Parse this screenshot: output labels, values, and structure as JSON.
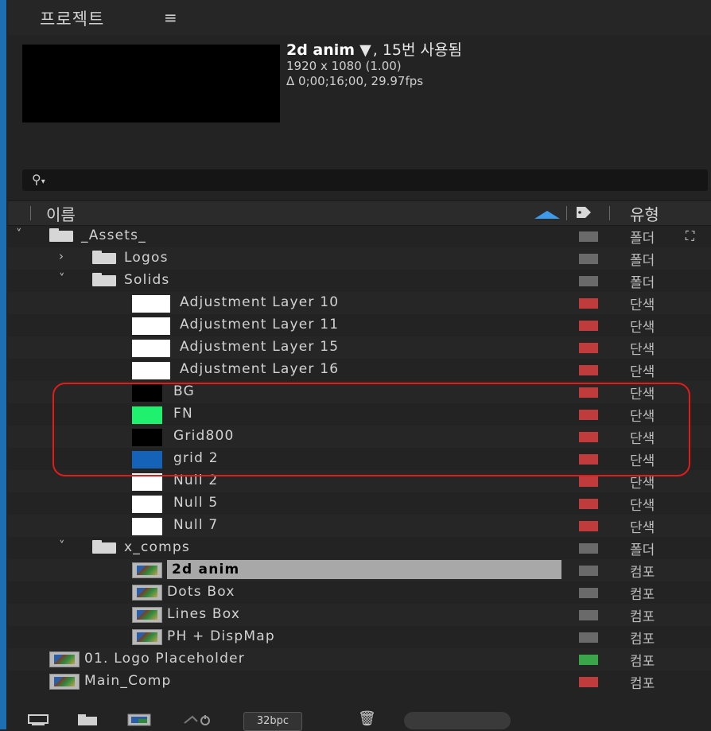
{
  "panel": {
    "title": "프로젝트",
    "menu_icon": "≡"
  },
  "preview": {
    "name": "2d anim",
    "caret": "▼",
    "usage": ", 15번 사용됨",
    "resolution": "1920 x 1080 (1.00)",
    "duration": "Δ 0;00;16;00, 29.97fps"
  },
  "search": {
    "value": "",
    "placeholder": ""
  },
  "columns": {
    "name": "이름",
    "type": "유형"
  },
  "items": [
    {
      "id": "assets",
      "indent": 0,
      "chevron": "˅",
      "icon": "folder",
      "name": "_Assets_",
      "label_color": "#6a6a6a",
      "type": "폴더"
    },
    {
      "id": "logos",
      "indent": 1,
      "chevron": "›",
      "icon": "folder",
      "name": "Logos",
      "label_color": "#6a6a6a",
      "type": "폴더"
    },
    {
      "id": "solids",
      "indent": 1,
      "chevron": "˅",
      "icon": "folder",
      "name": "Solids",
      "label_color": "#6a6a6a",
      "type": "폴더"
    },
    {
      "id": "adj10",
      "indent": 2,
      "icon": "solid",
      "swatch": "#ffffff",
      "name": "Adjustment Layer 10",
      "label_color": "#c03b3b",
      "type": "단색"
    },
    {
      "id": "adj11",
      "indent": 2,
      "icon": "solid",
      "swatch": "#ffffff",
      "name": "Adjustment Layer 11",
      "label_color": "#c03b3b",
      "type": "단색"
    },
    {
      "id": "adj15",
      "indent": 2,
      "icon": "solid",
      "swatch": "#ffffff",
      "name": "Adjustment Layer 15",
      "label_color": "#c03b3b",
      "type": "단색"
    },
    {
      "id": "adj16",
      "indent": 2,
      "icon": "solid",
      "swatch": "#ffffff",
      "name": "Adjustment Layer 16",
      "label_color": "#c03b3b",
      "type": "단색"
    },
    {
      "id": "bg",
      "indent": 2,
      "icon": "solid-small",
      "swatch": "#000000",
      "name": "BG",
      "label_color": "#c03b3b",
      "type": "단색"
    },
    {
      "id": "fn",
      "indent": 2,
      "icon": "solid-small",
      "swatch": "#1ff06e",
      "name": "FN",
      "label_color": "#c03b3b",
      "type": "단색"
    },
    {
      "id": "grid800",
      "indent": 2,
      "icon": "solid-small",
      "swatch": "#000000",
      "name": "Grid800",
      "label_color": "#c03b3b",
      "type": "단색"
    },
    {
      "id": "grid2",
      "indent": 2,
      "icon": "solid-small",
      "swatch": "#1463b8",
      "name": "grid 2",
      "label_color": "#c03b3b",
      "type": "단색"
    },
    {
      "id": "null2",
      "indent": 2,
      "icon": "solid-small",
      "swatch": "#ffffff",
      "name": "Null 2",
      "label_color": "#c03b3b",
      "type": "단색"
    },
    {
      "id": "null5",
      "indent": 2,
      "icon": "solid-small",
      "swatch": "#ffffff",
      "name": "Null 5",
      "label_color": "#c03b3b",
      "type": "단색"
    },
    {
      "id": "null7",
      "indent": 2,
      "icon": "solid-small",
      "swatch": "#ffffff",
      "name": "Null 7",
      "label_color": "#c03b3b",
      "type": "단색"
    },
    {
      "id": "xcomps",
      "indent": 1,
      "chevron": "˅",
      "icon": "folder",
      "name": "x_comps",
      "label_color": "#6a6a6a",
      "type": "폴더"
    },
    {
      "id": "anim2d",
      "indent": 2,
      "icon": "comp",
      "name": "2d anim",
      "label_color": "#6a6a6a",
      "type": "컴포",
      "selected": true
    },
    {
      "id": "dots",
      "indent": 2,
      "icon": "comp",
      "name": "Dots Box",
      "label_color": "#6a6a6a",
      "type": "컴포"
    },
    {
      "id": "lines",
      "indent": 2,
      "icon": "comp",
      "name": "Lines Box",
      "label_color": "#6a6a6a",
      "type": "컴포"
    },
    {
      "id": "ph",
      "indent": 2,
      "icon": "comp",
      "name": "PH + DispMap",
      "label_color": "#6a6a6a",
      "type": "컴포"
    },
    {
      "id": "logo01",
      "indent": 0,
      "icon": "comp",
      "name": "01. Logo Placeholder",
      "label_color": "#3aa64a",
      "type": "컴포"
    },
    {
      "id": "main",
      "indent": 0,
      "icon": "comp",
      "name": "Main_Comp",
      "label_color": "#c03b3b",
      "type": "컴포"
    }
  ],
  "bottom": {
    "bpc": "32bpc",
    "trash_icon": "🗑"
  },
  "colors": {
    "accent": "#3d9be9",
    "highlight": "#e21b1b"
  }
}
